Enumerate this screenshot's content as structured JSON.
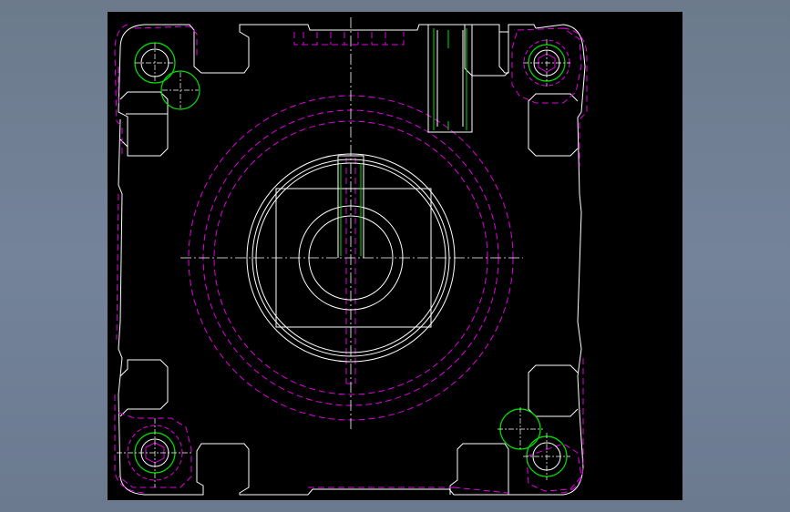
{
  "viewport": {
    "background": "#000000",
    "frame_color": "#6e7d92"
  },
  "colors": {
    "outline": "#ffffff",
    "hidden": "#e000e0",
    "bolt": "#00e000",
    "center": "#ffffff"
  },
  "drawing": {
    "name": "cylinder-end-cover-top-view",
    "bolt_holes": 4
  }
}
